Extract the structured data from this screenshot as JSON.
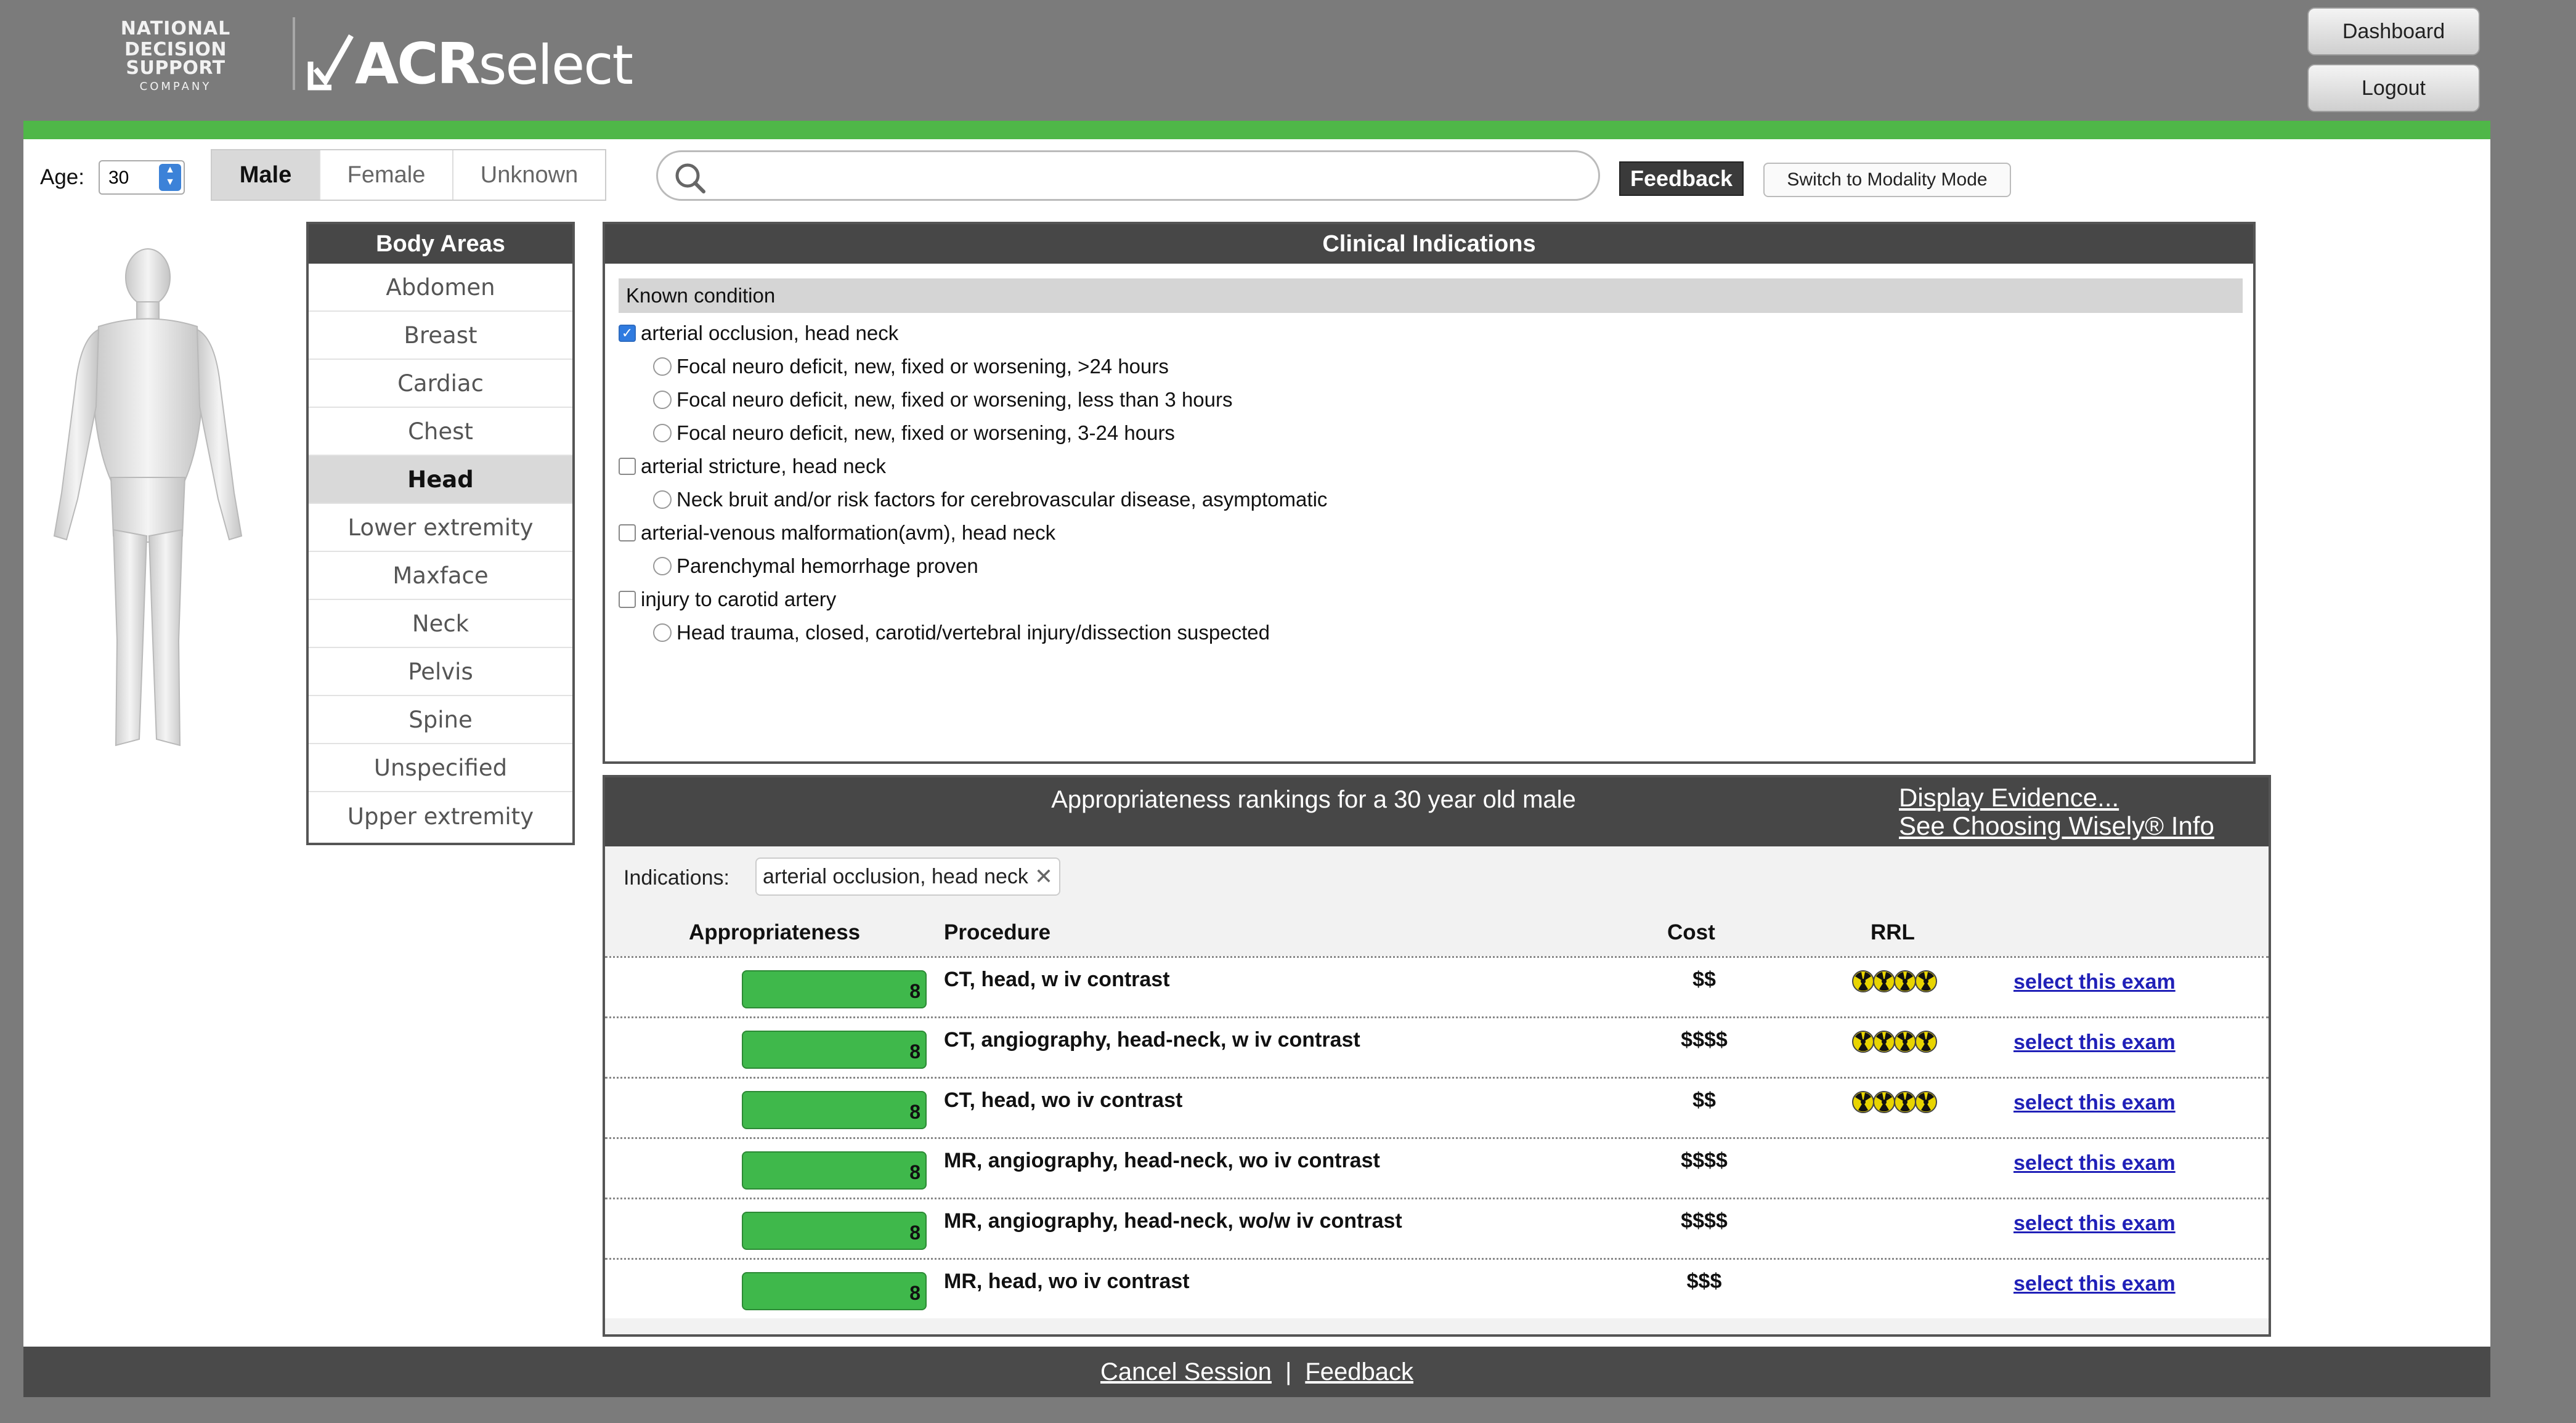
{
  "header": {
    "ndsc_logo_lines": [
      "NATIONAL",
      "DECISION SUPPORT",
      "COMPANY"
    ],
    "acr_logo_bold": "ACR",
    "acr_logo_light": "select",
    "dashboard_label": "Dashboard",
    "logout_label": "Logout"
  },
  "accent_color": "#4fb748",
  "toolbar": {
    "age_label": "Age:",
    "age_value": "30",
    "genders": [
      {
        "label": "Male",
        "selected": true
      },
      {
        "label": "Female",
        "selected": false
      },
      {
        "label": "Unknown",
        "selected": false
      }
    ],
    "search_placeholder": "",
    "feedback_label": "Feedback",
    "modality_label": "Switch to Modality Mode"
  },
  "body_areas": {
    "title": "Body Areas",
    "items": [
      "Abdomen",
      "Breast",
      "Cardiac",
      "Chest",
      "Head",
      "Lower extremity",
      "Maxface",
      "Neck",
      "Pelvis",
      "Spine",
      "Unspecified",
      "Upper extremity"
    ],
    "selected": "Head"
  },
  "clinical_indications": {
    "title": "Clinical Indications",
    "group_label": "Known condition",
    "conditions": [
      {
        "label": "arterial occlusion, head neck",
        "checked": true,
        "options": [
          "Focal neuro deficit, new, fixed or worsening, >24 hours",
          "Focal neuro deficit, new, fixed or worsening, less than 3 hours",
          "Focal neuro deficit, new, fixed or worsening, 3-24 hours"
        ]
      },
      {
        "label": "arterial stricture, head neck",
        "checked": false,
        "options": [
          "Neck bruit and/or risk factors for cerebrovascular disease, asymptomatic"
        ]
      },
      {
        "label": "arterial-venous malformation(avm), head neck",
        "checked": false,
        "options": [
          "Parenchymal hemorrhage proven"
        ]
      },
      {
        "label": "injury to carotid artery",
        "checked": false,
        "options": [
          "Head trauma, closed, carotid/vertebral injury/dissection suspected"
        ]
      }
    ]
  },
  "rankings": {
    "title": "Appropriateness rankings for a 30 year old male",
    "display_evidence": "Display Evidence...",
    "choosing_wisely": "See Choosing Wisely® Info",
    "indications_label": "Indications:",
    "indication_chip": "arterial occlusion, head neck",
    "chip_remove": "✕",
    "columns": {
      "appropriateness": "Appropriateness",
      "procedure": "Procedure",
      "cost": "Cost",
      "rrl": "RRL"
    },
    "max_score": 9,
    "rows": [
      {
        "score": "8",
        "procedure": "CT, head, w iv contrast",
        "cost": "$$",
        "rrl": 4,
        "action": "select this exam"
      },
      {
        "score": "8",
        "procedure": "CT, angiography, head-neck, w iv contrast",
        "cost": "$$$$",
        "rrl": 4,
        "action": "select this exam"
      },
      {
        "score": "8",
        "procedure": "CT, head, wo iv contrast",
        "cost": "$$",
        "rrl": 4,
        "action": "select this exam"
      },
      {
        "score": "8",
        "procedure": "MR, angiography, head-neck, wo iv contrast",
        "cost": "$$$$",
        "rrl": 0,
        "action": "select this exam"
      },
      {
        "score": "8",
        "procedure": "MR, angiography, head-neck, wo/w iv contrast",
        "cost": "$$$$",
        "rrl": 0,
        "action": "select this exam"
      },
      {
        "score": "8",
        "procedure": "MR, head, wo iv contrast",
        "cost": "$$$",
        "rrl": 0,
        "action": "select this exam"
      }
    ]
  },
  "footer": {
    "cancel_label": "Cancel Session",
    "separator": "|",
    "feedback_label": "Feedback"
  }
}
